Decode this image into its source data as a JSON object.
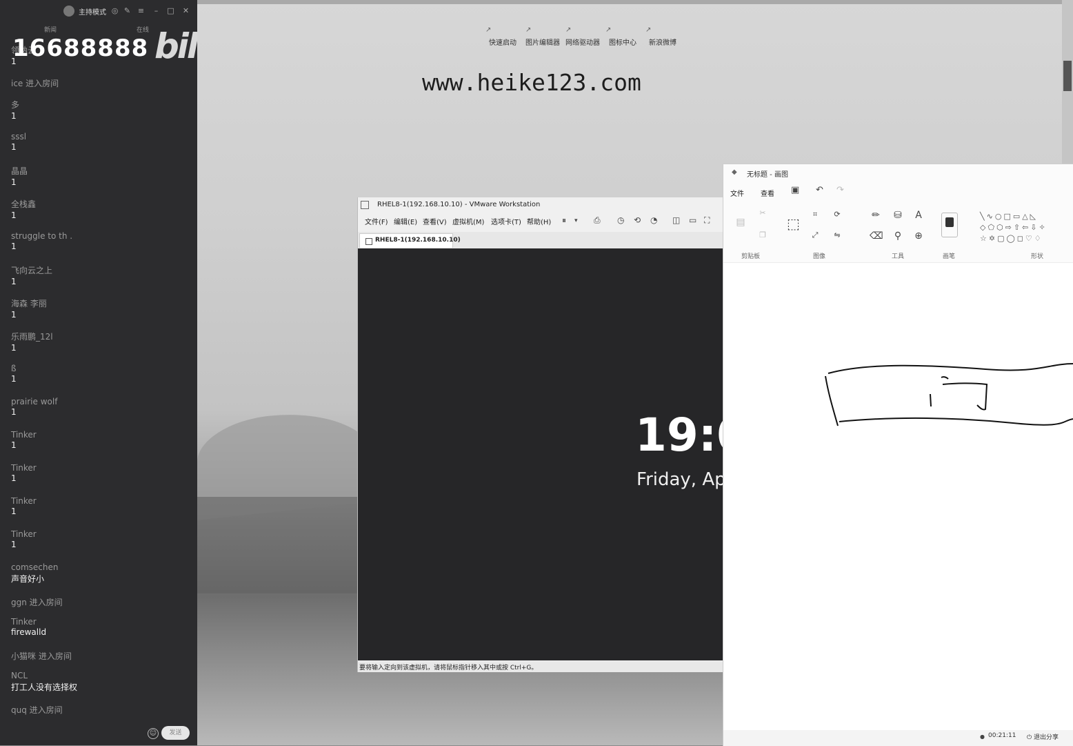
{
  "chat": {
    "mode_label": "主持模式",
    "tabs": [
      "新闻",
      "在线"
    ],
    "room_number": "16688888",
    "logo": "bilibili",
    "messages": [
      {
        "user": "领纳云",
        "text": "1"
      },
      {
        "user": "ice 进入房间",
        "text": ""
      },
      {
        "user": "多",
        "text": "1"
      },
      {
        "user": "sssl",
        "text": "1"
      },
      {
        "user": "晶晶",
        "text": "1"
      },
      {
        "user": "全栈鑫",
        "text": "1"
      },
      {
        "user": "struggle to th .",
        "text": "1"
      },
      {
        "user": "飞向云之上",
        "text": "1"
      },
      {
        "user": "海森 李丽",
        "text": "1"
      },
      {
        "user": "乐雨鹏_12l",
        "text": "1"
      },
      {
        "user": "ß",
        "text": "1"
      },
      {
        "user": "prairie wolf",
        "text": "1"
      },
      {
        "user": "Tinker",
        "text": "1"
      },
      {
        "user": "Tinker",
        "text": "1"
      },
      {
        "user": "Tinker",
        "text": "1"
      },
      {
        "user": "Tinker",
        "text": "1"
      },
      {
        "user": "comsechen",
        "text": "声音好小"
      },
      {
        "user": "ggn 进入房间",
        "text": ""
      },
      {
        "user": "Tinker",
        "text": "firewalld"
      },
      {
        "user": "小猫咪 进入房间",
        "text": ""
      },
      {
        "user": "NCL",
        "text": "打工人没有选择权"
      },
      {
        "user": "quq 进入房间",
        "text": ""
      }
    ],
    "emoji_icon": "☺",
    "send_label": "发送"
  },
  "desktop": {
    "shortcuts": [
      "快速启动",
      "图片编辑器",
      "网络驱动器",
      "图标中心",
      "新浪微博"
    ],
    "watermark": "www.heike123.com"
  },
  "vmware": {
    "title": "RHEL8-1(192.168.10.10) - VMware Workstation",
    "menus": [
      "文件(F)",
      "编辑(E)",
      "查看(V)",
      "虚拟机(M)",
      "选项卡(T)",
      "帮助(H)"
    ],
    "tab_label": "RHEL8-1(192.168.10.10)",
    "clock": "19:0",
    "date": "Friday, Ap",
    "status": "要将输入定向到该虚拟机，请将鼠标指针移入其中或按 Ctrl+G。"
  },
  "paint": {
    "title": "无标题 - 画图",
    "menus": [
      "文件",
      "查看"
    ],
    "groups": [
      "剪贴板",
      "图像",
      "工具",
      "画笔",
      "形状"
    ],
    "timer": "00:21:11",
    "exit_share": "退出分享"
  }
}
